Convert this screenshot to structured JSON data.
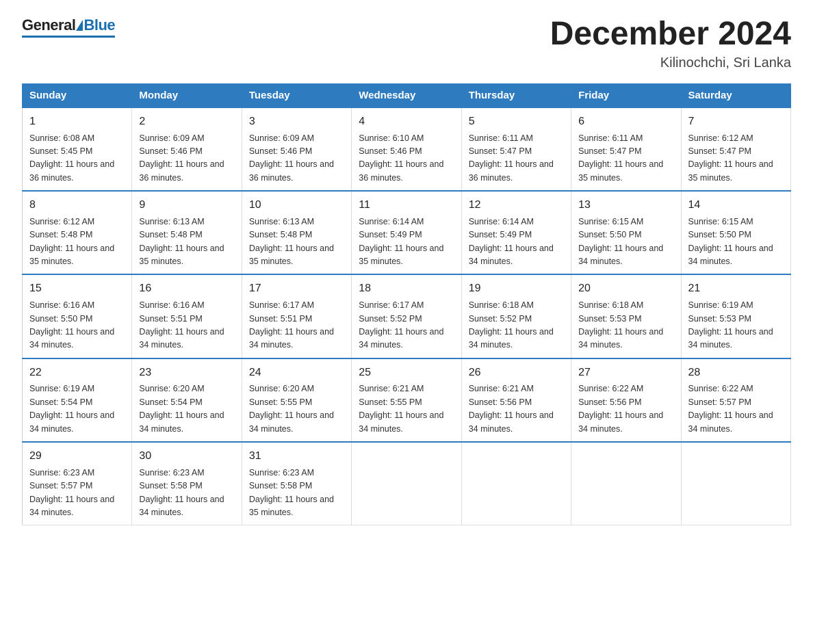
{
  "logo": {
    "general": "General",
    "blue": "Blue"
  },
  "title": "December 2024",
  "location": "Kilinochchi, Sri Lanka",
  "weekdays": [
    "Sunday",
    "Monday",
    "Tuesday",
    "Wednesday",
    "Thursday",
    "Friday",
    "Saturday"
  ],
  "weeks": [
    [
      {
        "day": 1,
        "sunrise": "6:08 AM",
        "sunset": "5:45 PM",
        "daylight": "11 hours and 36 minutes."
      },
      {
        "day": 2,
        "sunrise": "6:09 AM",
        "sunset": "5:46 PM",
        "daylight": "11 hours and 36 minutes."
      },
      {
        "day": 3,
        "sunrise": "6:09 AM",
        "sunset": "5:46 PM",
        "daylight": "11 hours and 36 minutes."
      },
      {
        "day": 4,
        "sunrise": "6:10 AM",
        "sunset": "5:46 PM",
        "daylight": "11 hours and 36 minutes."
      },
      {
        "day": 5,
        "sunrise": "6:11 AM",
        "sunset": "5:47 PM",
        "daylight": "11 hours and 36 minutes."
      },
      {
        "day": 6,
        "sunrise": "6:11 AM",
        "sunset": "5:47 PM",
        "daylight": "11 hours and 35 minutes."
      },
      {
        "day": 7,
        "sunrise": "6:12 AM",
        "sunset": "5:47 PM",
        "daylight": "11 hours and 35 minutes."
      }
    ],
    [
      {
        "day": 8,
        "sunrise": "6:12 AM",
        "sunset": "5:48 PM",
        "daylight": "11 hours and 35 minutes."
      },
      {
        "day": 9,
        "sunrise": "6:13 AM",
        "sunset": "5:48 PM",
        "daylight": "11 hours and 35 minutes."
      },
      {
        "day": 10,
        "sunrise": "6:13 AM",
        "sunset": "5:48 PM",
        "daylight": "11 hours and 35 minutes."
      },
      {
        "day": 11,
        "sunrise": "6:14 AM",
        "sunset": "5:49 PM",
        "daylight": "11 hours and 35 minutes."
      },
      {
        "day": 12,
        "sunrise": "6:14 AM",
        "sunset": "5:49 PM",
        "daylight": "11 hours and 34 minutes."
      },
      {
        "day": 13,
        "sunrise": "6:15 AM",
        "sunset": "5:50 PM",
        "daylight": "11 hours and 34 minutes."
      },
      {
        "day": 14,
        "sunrise": "6:15 AM",
        "sunset": "5:50 PM",
        "daylight": "11 hours and 34 minutes."
      }
    ],
    [
      {
        "day": 15,
        "sunrise": "6:16 AM",
        "sunset": "5:50 PM",
        "daylight": "11 hours and 34 minutes."
      },
      {
        "day": 16,
        "sunrise": "6:16 AM",
        "sunset": "5:51 PM",
        "daylight": "11 hours and 34 minutes."
      },
      {
        "day": 17,
        "sunrise": "6:17 AM",
        "sunset": "5:51 PM",
        "daylight": "11 hours and 34 minutes."
      },
      {
        "day": 18,
        "sunrise": "6:17 AM",
        "sunset": "5:52 PM",
        "daylight": "11 hours and 34 minutes."
      },
      {
        "day": 19,
        "sunrise": "6:18 AM",
        "sunset": "5:52 PM",
        "daylight": "11 hours and 34 minutes."
      },
      {
        "day": 20,
        "sunrise": "6:18 AM",
        "sunset": "5:53 PM",
        "daylight": "11 hours and 34 minutes."
      },
      {
        "day": 21,
        "sunrise": "6:19 AM",
        "sunset": "5:53 PM",
        "daylight": "11 hours and 34 minutes."
      }
    ],
    [
      {
        "day": 22,
        "sunrise": "6:19 AM",
        "sunset": "5:54 PM",
        "daylight": "11 hours and 34 minutes."
      },
      {
        "day": 23,
        "sunrise": "6:20 AM",
        "sunset": "5:54 PM",
        "daylight": "11 hours and 34 minutes."
      },
      {
        "day": 24,
        "sunrise": "6:20 AM",
        "sunset": "5:55 PM",
        "daylight": "11 hours and 34 minutes."
      },
      {
        "day": 25,
        "sunrise": "6:21 AM",
        "sunset": "5:55 PM",
        "daylight": "11 hours and 34 minutes."
      },
      {
        "day": 26,
        "sunrise": "6:21 AM",
        "sunset": "5:56 PM",
        "daylight": "11 hours and 34 minutes."
      },
      {
        "day": 27,
        "sunrise": "6:22 AM",
        "sunset": "5:56 PM",
        "daylight": "11 hours and 34 minutes."
      },
      {
        "day": 28,
        "sunrise": "6:22 AM",
        "sunset": "5:57 PM",
        "daylight": "11 hours and 34 minutes."
      }
    ],
    [
      {
        "day": 29,
        "sunrise": "6:23 AM",
        "sunset": "5:57 PM",
        "daylight": "11 hours and 34 minutes."
      },
      {
        "day": 30,
        "sunrise": "6:23 AM",
        "sunset": "5:58 PM",
        "daylight": "11 hours and 34 minutes."
      },
      {
        "day": 31,
        "sunrise": "6:23 AM",
        "sunset": "5:58 PM",
        "daylight": "11 hours and 35 minutes."
      },
      null,
      null,
      null,
      null
    ]
  ]
}
